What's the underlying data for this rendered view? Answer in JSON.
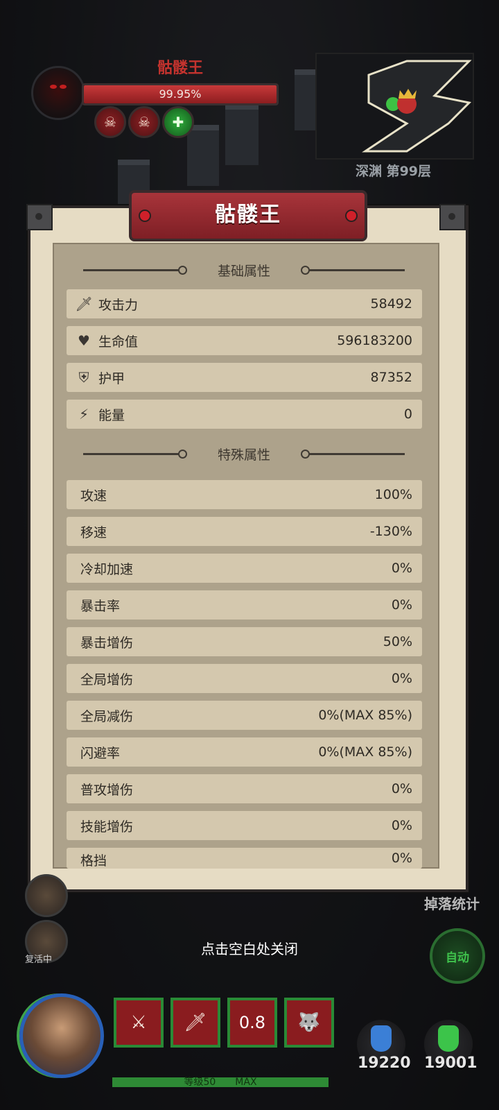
{
  "boss_hud": {
    "name": "骷髅王",
    "hp_percent_text": "99.95%",
    "hp_fraction": 0.9995,
    "buff_icons": [
      "skull-icon",
      "skull-icon",
      "heal-cross-icon"
    ]
  },
  "minimap": {
    "location": "深渊 第99层"
  },
  "popup": {
    "title": "骷髅王",
    "basic_section_title": "基础属性",
    "basic_stats": [
      {
        "icon": "sword-icon",
        "label": "攻击力",
        "value": "58492"
      },
      {
        "icon": "heart-icon",
        "label": "生命值",
        "value": "596183200"
      },
      {
        "icon": "shield-icon",
        "label": "护甲",
        "value": "87352"
      },
      {
        "icon": "energy-icon",
        "label": "能量",
        "value": "0"
      }
    ],
    "special_section_title": "特殊属性",
    "special_stats": [
      {
        "label": "攻速",
        "value": "100%"
      },
      {
        "label": "移速",
        "value": "-130%"
      },
      {
        "label": "冷却加速",
        "value": "0%"
      },
      {
        "label": "暴击率",
        "value": "0%"
      },
      {
        "label": "暴击增伤",
        "value": "50%"
      },
      {
        "label": "全局增伤",
        "value": "0%"
      },
      {
        "label": "全局减伤",
        "value": "0%(MAX 85%)"
      },
      {
        "label": "闪避率",
        "value": "0%(MAX 85%)"
      },
      {
        "label": "普攻增伤",
        "value": "0%"
      },
      {
        "label": "技能增伤",
        "value": "0%"
      },
      {
        "label": "格挡",
        "value": "0%"
      }
    ],
    "close_hint": "点击空白处关闭"
  },
  "side": {
    "revive_label": "复活中",
    "drop_stats_label": "掉落统计",
    "auto_label": "自动"
  },
  "bottom": {
    "skill_cooldown": "0.8",
    "level_label": "等级50",
    "level_max": "MAX",
    "potions": [
      {
        "name": "blue-potion",
        "count": "19220",
        "color": "#3b7fd6"
      },
      {
        "name": "green-potion",
        "count": "19001",
        "color": "#3cc44a"
      }
    ]
  }
}
